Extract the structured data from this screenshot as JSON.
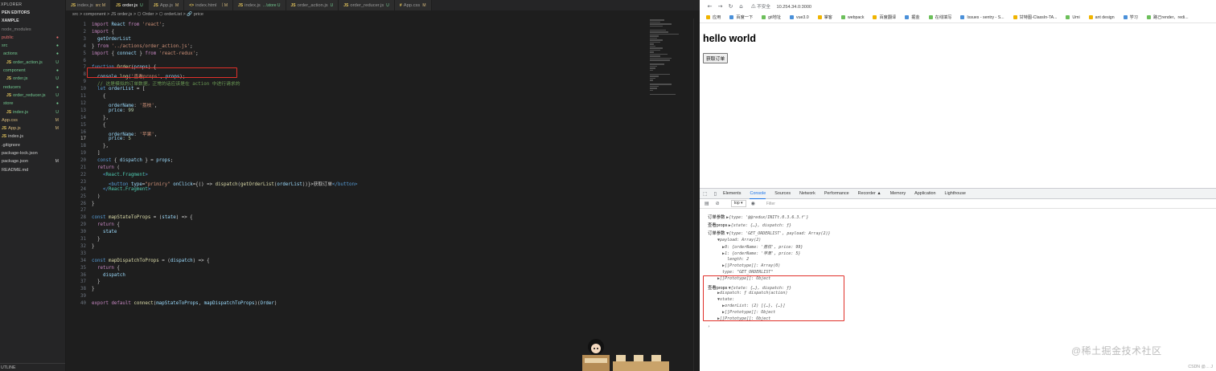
{
  "explorer": {
    "title": "XPLORER",
    "section_open_editors": "PEN EDITORS",
    "section_project": "XAMPLE",
    "items": [
      {
        "label": "node_modules",
        "badge": "",
        "color": "gray",
        "icon": ""
      },
      {
        "label": "public",
        "badge": "●",
        "color": "red",
        "icon": ""
      },
      {
        "label": "src",
        "badge": "●",
        "color": "green",
        "icon": ""
      },
      {
        "label": "actions",
        "badge": "●",
        "color": "green",
        "icon": ""
      },
      {
        "label": "order_action.js",
        "badge": "U",
        "color": "green",
        "icon": "JS"
      },
      {
        "label": "component",
        "badge": "●",
        "color": "green",
        "icon": ""
      },
      {
        "label": "order.js",
        "badge": "U",
        "color": "green",
        "icon": "JS"
      },
      {
        "label": "reducers",
        "badge": "●",
        "color": "green",
        "icon": ""
      },
      {
        "label": "order_reducer.js",
        "badge": "U",
        "color": "green",
        "icon": "JS"
      },
      {
        "label": "store",
        "badge": "●",
        "color": "green",
        "icon": ""
      },
      {
        "label": "index.js",
        "badge": "U",
        "color": "green",
        "icon": "JS"
      },
      {
        "label": "App.css",
        "badge": "M",
        "color": "yellow",
        "icon": ""
      },
      {
        "label": "App.js",
        "badge": "M",
        "color": "yellow",
        "icon": "JS"
      },
      {
        "label": "index.js",
        "badge": "",
        "color": "white",
        "icon": "JS"
      },
      {
        "label": ".gitignore",
        "badge": "",
        "color": "white",
        "icon": ""
      },
      {
        "label": "package-lock.json",
        "badge": "",
        "color": "white",
        "icon": ""
      },
      {
        "label": "package.json",
        "badge": "M",
        "color": "white",
        "icon": ""
      },
      {
        "label": "README.md",
        "badge": "",
        "color": "white",
        "icon": ""
      }
    ],
    "outline": "UTLINE"
  },
  "tabs": [
    {
      "label": "index.js",
      "suffix": "src M",
      "active": false,
      "icon": "JS"
    },
    {
      "label": "order.js",
      "suffix": "U",
      "active": true,
      "icon": "JS"
    },
    {
      "label": "App.js",
      "suffix": "M",
      "active": false,
      "icon": "JS"
    },
    {
      "label": "index.html",
      "suffix": "〔 M",
      "active": false,
      "icon": "<>"
    },
    {
      "label": "index.js",
      "suffix": "...\\store U",
      "active": false,
      "icon": "JS"
    },
    {
      "label": "order_action.js",
      "suffix": "U",
      "active": false,
      "icon": "JS"
    },
    {
      "label": "order_reducer.js",
      "suffix": "U",
      "active": false,
      "icon": "JS"
    },
    {
      "label": "App.css",
      "suffix": "M",
      "active": false,
      "icon": "#"
    }
  ],
  "breadcrumb": "src > component > JS order.js > ⬡ Order > ⬡ orderList > 🔗 price",
  "code": {
    "current_line": 17,
    "lines": [
      [
        [
          "import ",
          "k"
        ],
        [
          "React ",
          "v"
        ],
        [
          "from ",
          "k"
        ],
        [
          "'react'",
          "s"
        ],
        [
          ";",
          ""
        ]
      ],
      [
        [
          "import ",
          "k"
        ],
        [
          "{",
          ""
        ]
      ],
      [
        [
          "  getOrderList",
          "v"
        ]
      ],
      [
        [
          "} ",
          ""
        ],
        [
          "from ",
          "k"
        ],
        [
          "'../actions/order_action.js'",
          "s"
        ],
        [
          ";",
          ""
        ]
      ],
      [
        [
          "import ",
          "k"
        ],
        [
          "{ ",
          ""
        ],
        [
          "connect ",
          "v"
        ],
        [
          "} ",
          ""
        ],
        [
          "from ",
          "k"
        ],
        [
          "'react-redux'",
          "s"
        ],
        [
          ";",
          ""
        ]
      ],
      [],
      [
        [
          "function ",
          "kb"
        ],
        [
          "Order",
          "f"
        ],
        [
          "(",
          ""
        ],
        [
          "props",
          "v"
        ],
        [
          ") {",
          ""
        ]
      ],
      [
        [
          "  console",
          "v"
        ],
        [
          ".",
          ""
        ],
        [
          "log",
          "f"
        ],
        [
          "(",
          ""
        ],
        [
          "'查看props'",
          "s"
        ],
        [
          ", ",
          ""
        ],
        [
          "props",
          "v"
        ],
        [
          ");",
          ""
        ]
      ],
      [
        [
          "  // 这是模拟的订单数据，正常的话应该是在 action 中进行请求的",
          "cm"
        ]
      ],
      [
        [
          "  let ",
          "kb"
        ],
        [
          "orderList ",
          "v"
        ],
        [
          "= [",
          ""
        ]
      ],
      [
        [
          "    {",
          ""
        ]
      ],
      [
        [
          "      orderName",
          "v"
        ],
        [
          ": ",
          ""
        ],
        [
          "'荔枝'",
          "s"
        ],
        [
          ",",
          ""
        ]
      ],
      [
        [
          "      price",
          "v"
        ],
        [
          ": ",
          ""
        ],
        [
          "99",
          "n"
        ]
      ],
      [
        [
          "    },",
          ""
        ]
      ],
      [
        [
          "    {",
          ""
        ]
      ],
      [
        [
          "      orderName",
          "v"
        ],
        [
          ": ",
          ""
        ],
        [
          "'苹果'",
          "s"
        ],
        [
          ",",
          ""
        ]
      ],
      [
        [
          "      price",
          "v"
        ],
        [
          ": ",
          ""
        ],
        [
          "5",
          "n"
        ]
      ],
      [
        [
          "    },",
          ""
        ]
      ],
      [
        [
          "  ]",
          ""
        ]
      ],
      [
        [
          "  const ",
          "kb"
        ],
        [
          "{ ",
          ""
        ],
        [
          "dispatch ",
          "v"
        ],
        [
          "} = ",
          ""
        ],
        [
          "props",
          "v"
        ],
        [
          ";",
          ""
        ]
      ],
      [
        [
          "  return ",
          "k"
        ],
        [
          "(",
          ""
        ]
      ],
      [
        [
          "    <",
          "tag"
        ],
        [
          "React.Fragment",
          "ty"
        ],
        [
          ">",
          "tag"
        ]
      ],
      [
        [
          "      <",
          "tag"
        ],
        [
          "button ",
          "tag"
        ],
        [
          "type",
          "at"
        ],
        [
          "=",
          ""
        ],
        [
          "\"primiry\" ",
          "s"
        ],
        [
          "onClick",
          "at"
        ],
        [
          "={() => ",
          ""
        ],
        [
          "dispatch",
          "f"
        ],
        [
          "(",
          ""
        ],
        [
          "getOrderList",
          "f"
        ],
        [
          "(",
          ""
        ],
        [
          "orderList",
          "v"
        ],
        [
          "))}>",
          ""
        ],
        [
          "获取订单",
          "white"
        ],
        [
          "</",
          "tag"
        ],
        [
          "button",
          "tag"
        ],
        [
          ">",
          "tag"
        ]
      ],
      [
        [
          "    </",
          "tag"
        ],
        [
          "React.Fragment",
          "ty"
        ],
        [
          ">",
          "tag"
        ]
      ],
      [
        [
          "  )",
          ""
        ]
      ],
      [
        [
          "}",
          ""
        ]
      ],
      [],
      [
        [
          "const ",
          "kb"
        ],
        [
          "mapStateToProps ",
          "f"
        ],
        [
          "= (",
          ""
        ],
        [
          "state",
          "v"
        ],
        [
          ") => {",
          ""
        ]
      ],
      [
        [
          "  return ",
          "k"
        ],
        [
          "{",
          ""
        ]
      ],
      [
        [
          "    state",
          "v"
        ]
      ],
      [
        [
          "  }",
          ""
        ]
      ],
      [
        [
          "}",
          ""
        ]
      ],
      [],
      [
        [
          "const ",
          "kb"
        ],
        [
          "mapDispatchToProps ",
          "f"
        ],
        [
          "= (",
          ""
        ],
        [
          "dispatch",
          "v"
        ],
        [
          ") => {",
          ""
        ]
      ],
      [
        [
          "  return ",
          "k"
        ],
        [
          "{",
          ""
        ]
      ],
      [
        [
          "    dispatch",
          "v"
        ]
      ],
      [
        [
          "  }",
          ""
        ]
      ],
      [
        [
          "}",
          ""
        ]
      ],
      [],
      [
        [
          "export ",
          "k"
        ],
        [
          "default ",
          "k"
        ],
        [
          "connect",
          "f"
        ],
        [
          "(",
          ""
        ],
        [
          "mapStateToProps",
          "v"
        ],
        [
          ", ",
          ""
        ],
        [
          "mapDispatchToProps",
          "v"
        ],
        [
          ")(",
          ""
        ],
        [
          "Order",
          "v"
        ],
        [
          ")",
          ""
        ]
      ]
    ]
  },
  "browser": {
    "security": "⚠ 不安全",
    "url": "10.254.34.0:3000",
    "bookmarks": [
      "应用",
      "百度一下",
      "git地址",
      "vue3.0",
      "掌客",
      "webpack",
      "百度翻译",
      "掘金",
      "在线填写",
      "Issues - sentry - S...",
      "甘特图-ClassIn-TA...",
      "Umi",
      "ant design",
      "学习",
      "路己render、redi..."
    ],
    "heading": "hello world",
    "button_label": "获取订单"
  },
  "devtools": {
    "tabs": [
      "Elements",
      "Console",
      "Sources",
      "Network",
      "Performance",
      "Recorder ▲",
      "Memory",
      "Application",
      "Lighthouse"
    ],
    "active_tab": "Console",
    "context": "top ▾",
    "filter_placeholder": "Filter",
    "console_lines": [
      {
        "label": "订单参数",
        "text": "▶{type: '@@redux/INITt.0.3.6.3.f'}"
      },
      {
        "label": "查看props",
        "text": "▶{state: {…}, dispatch: ƒ}"
      },
      {
        "label": "订单参数",
        "text": "▼{type: 'GET_ORDERLIST', payload: Array(2)}"
      },
      {
        "label": "",
        "text": "    ▼payload: Array(2)"
      },
      {
        "label": "",
        "text": "      ▶0: {orderName: '荔枝', price: 99}"
      },
      {
        "label": "",
        "text": "      ▶1: {orderName: '苹果', price: 5}"
      },
      {
        "label": "",
        "text": "        length: 2"
      },
      {
        "label": "",
        "text": "      ▶[[Prototype]]: Array(0)"
      },
      {
        "label": "",
        "text": "      type: \"GET_ORDERLIST\""
      },
      {
        "label": "",
        "text": "    ▶[[Prototype]]: Object"
      },
      {
        "label": "查看props",
        "text": "▼{state: {…}, dispatch: ƒ}"
      },
      {
        "label": "",
        "text": "    ▶dispatch: ƒ dispatch(action)"
      },
      {
        "label": "",
        "text": "    ▼state:"
      },
      {
        "label": "",
        "text": "      ▶orderList: (2) [{…}, {…}]"
      },
      {
        "label": "",
        "text": "      ▶[[Prototype]]: Object"
      },
      {
        "label": "",
        "text": "    ▶[[Prototype]]: Object"
      },
      {
        "label": "",
        "text": "›"
      }
    ]
  },
  "watermark": "@稀土掘金技术社区",
  "csdn": "CSDN @… J"
}
